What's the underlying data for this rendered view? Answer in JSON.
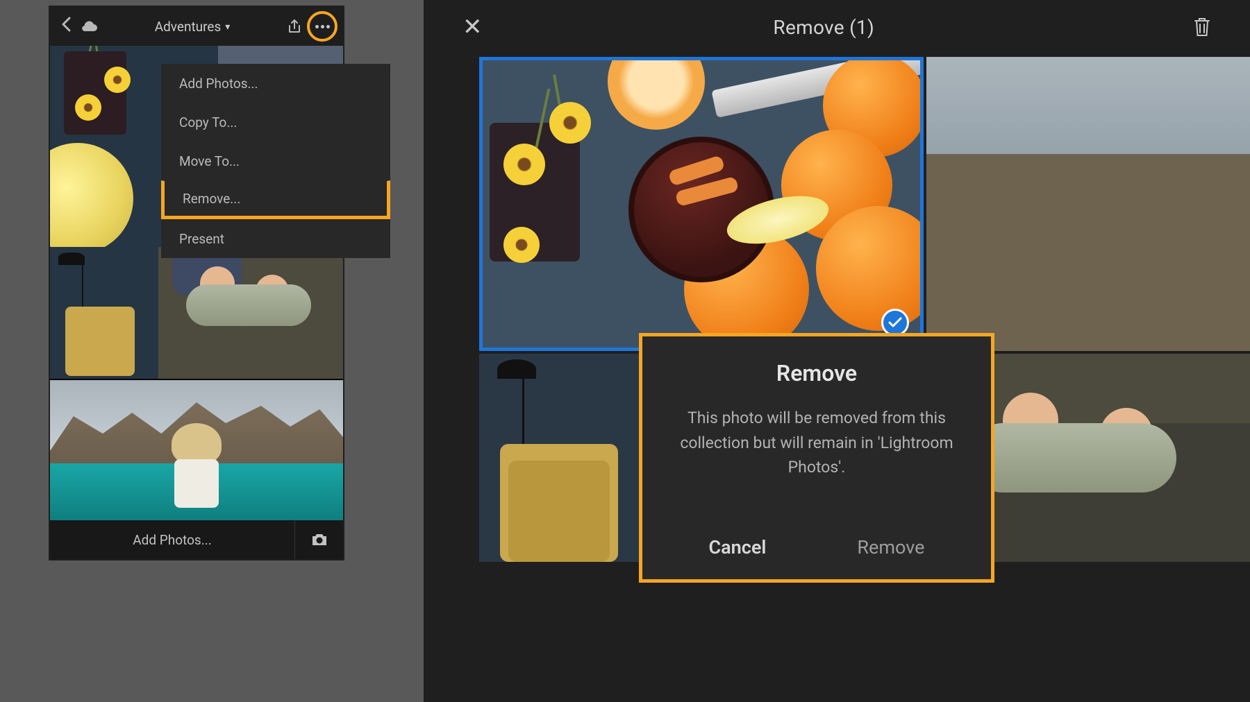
{
  "left": {
    "header": {
      "title": "Adventures"
    },
    "menu": {
      "items": [
        {
          "label": "Add Photos..."
        },
        {
          "label": "Copy To..."
        },
        {
          "label": "Move To..."
        },
        {
          "label": "Remove...",
          "highlighted": true
        },
        {
          "label": "Present"
        }
      ]
    },
    "footer": {
      "add_label": "Add Photos..."
    }
  },
  "right": {
    "header": {
      "title": "Remove  (1)"
    },
    "dialog": {
      "title": "Remove",
      "body": "This photo will be removed from this collection but will remain in 'Lightroom Photos'.",
      "cancel_label": "Cancel",
      "confirm_label": "Remove"
    }
  },
  "colors": {
    "highlight": "#f6a623",
    "select_blue": "#1f76d9"
  }
}
